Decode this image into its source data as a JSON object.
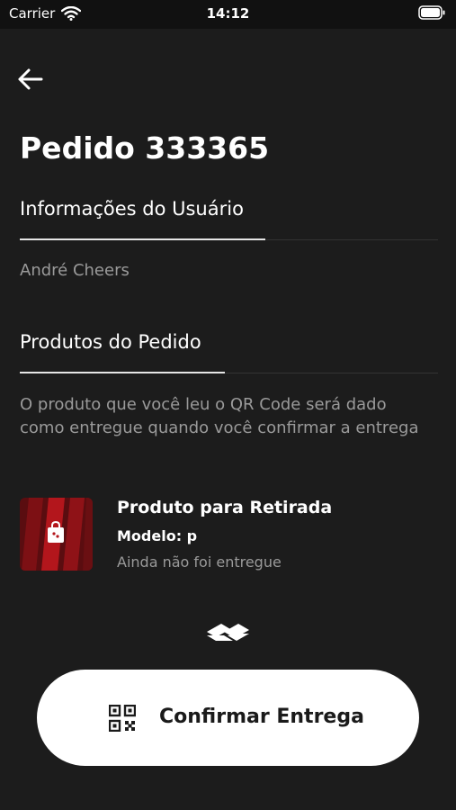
{
  "status_bar": {
    "carrier": "Carrier",
    "time": "14:12"
  },
  "header": {
    "title": "Pedido 333365"
  },
  "user_section": {
    "title": "Informações do Usuário",
    "name": "André Cheers"
  },
  "products_section": {
    "title": "Produtos do Pedido",
    "info": "O produto que você leu o QR Code será dado como entregue quando você confirmar a entrega",
    "items": [
      {
        "name": "Produto para Retirada",
        "model": "Modelo: p",
        "status": "Ainda não foi entregue",
        "icon": "shopping-bag-icon"
      }
    ]
  },
  "actions": {
    "confirm_label": "Confirmar Entrega",
    "confirm_icon": "qr-code-icon"
  },
  "colors": {
    "background": "#1c1c1c",
    "accent_red": "#b3161c",
    "button_bg": "#ffffff"
  }
}
